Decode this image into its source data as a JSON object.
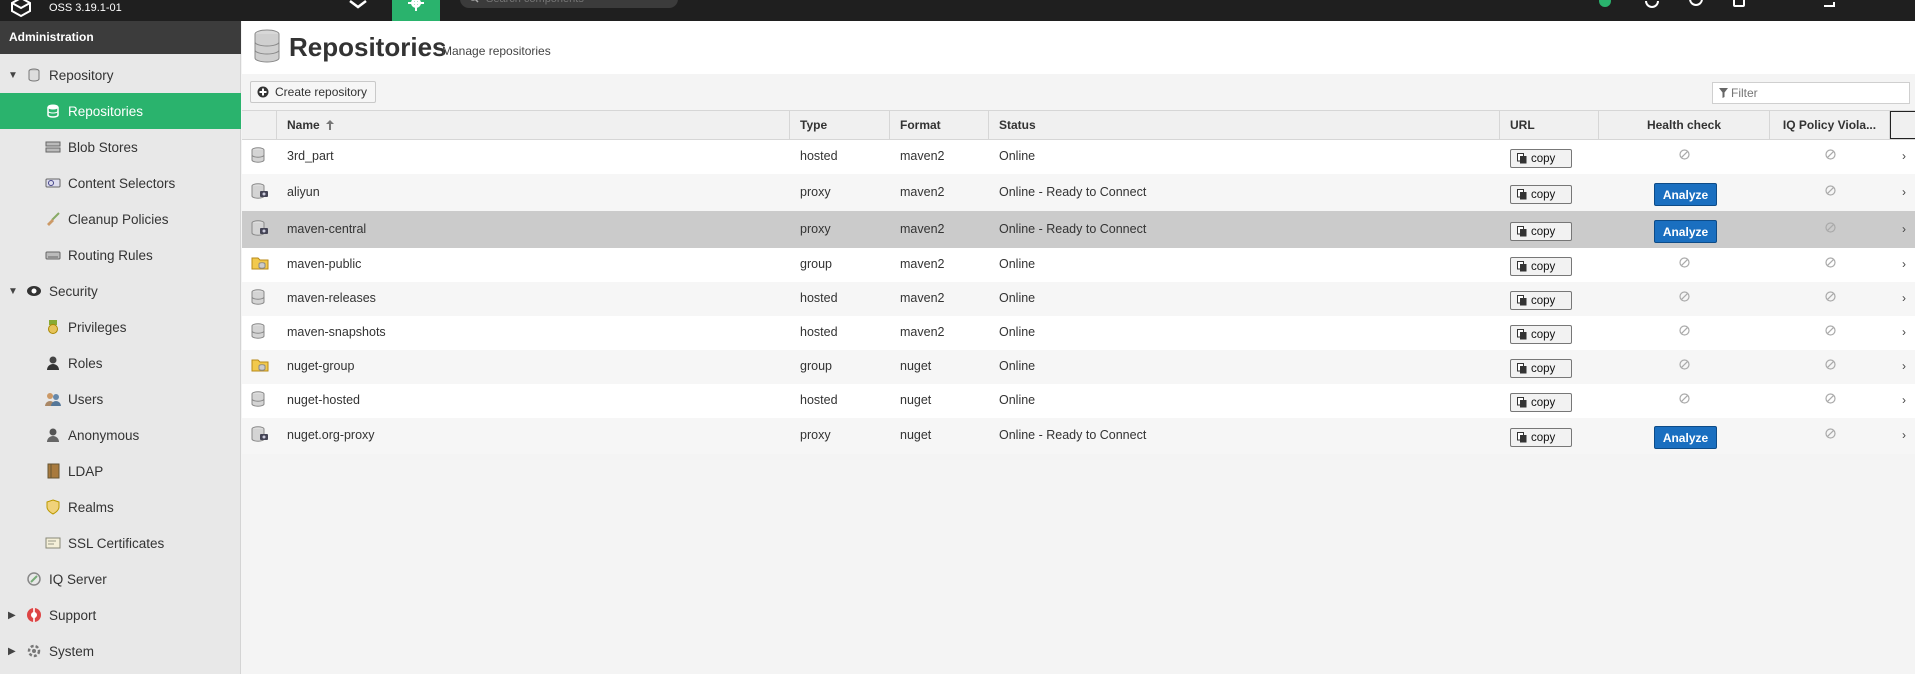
{
  "app": {
    "version": "OSS 3.19.1-01"
  },
  "search": {
    "placeholder": "Search components"
  },
  "sidebar": {
    "header": "Administration",
    "groups": [
      {
        "label": "Repository"
      },
      {
        "label": "Security"
      },
      {
        "label": "IQ Server"
      },
      {
        "label": "Support"
      },
      {
        "label": "System"
      }
    ],
    "items": [
      {
        "label": "Repositories"
      },
      {
        "label": "Blob Stores"
      },
      {
        "label": "Content Selectors"
      },
      {
        "label": "Cleanup Policies"
      },
      {
        "label": "Routing Rules"
      },
      {
        "label": "Privileges"
      },
      {
        "label": "Roles"
      },
      {
        "label": "Users"
      },
      {
        "label": "Anonymous"
      },
      {
        "label": "LDAP"
      },
      {
        "label": "Realms"
      },
      {
        "label": "SSL Certificates"
      }
    ]
  },
  "page": {
    "title": "Repositories",
    "subtitle": "Manage repositories"
  },
  "toolbar": {
    "create_label": "Create repository",
    "filter_placeholder": "Filter"
  },
  "grid": {
    "columns": {
      "name": "Name",
      "type": "Type",
      "format": "Format",
      "status": "Status",
      "url": "URL",
      "health": "Health check",
      "iq": "IQ Policy Viola..."
    },
    "copy_label": "copy",
    "analyze_label": "Analyze",
    "rows": [
      {
        "name": "3rd_part",
        "type": "hosted",
        "format": "maven2",
        "status": "Online"
      },
      {
        "name": "aliyun",
        "type": "proxy",
        "format": "maven2",
        "status": "Online - Ready to Connect"
      },
      {
        "name": "maven-central",
        "type": "proxy",
        "format": "maven2",
        "status": "Online - Ready to Connect"
      },
      {
        "name": "maven-public",
        "type": "group",
        "format": "maven2",
        "status": "Online"
      },
      {
        "name": "maven-releases",
        "type": "hosted",
        "format": "maven2",
        "status": "Online"
      },
      {
        "name": "maven-snapshots",
        "type": "hosted",
        "format": "maven2",
        "status": "Online"
      },
      {
        "name": "nuget-group",
        "type": "group",
        "format": "nuget",
        "status": "Online"
      },
      {
        "name": "nuget-hosted",
        "type": "hosted",
        "format": "nuget",
        "status": "Online"
      },
      {
        "name": "nuget.org-proxy",
        "type": "proxy",
        "format": "nuget",
        "status": "Online - Ready to Connect"
      }
    ]
  },
  "colors": {
    "accent": "#2ab36d",
    "analyze": "#1a6fc0",
    "topbar": "#1f1f1f"
  }
}
